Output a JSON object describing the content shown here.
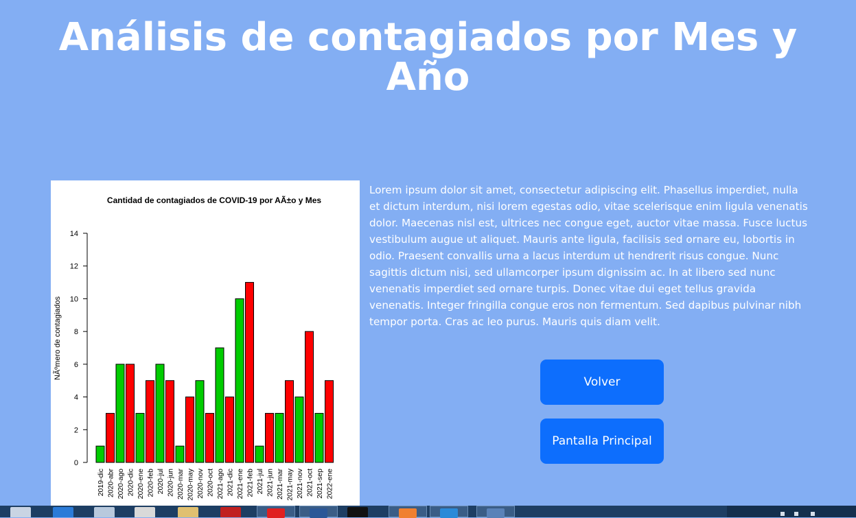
{
  "page": {
    "title": "Análisis de contagiados por Mes y Año",
    "description": "Lorem ipsum dolor sit amet, consectetur adipiscing elit. Phasellus imperdiet, nulla et dictum interdum, nisi lorem egestas odio, vitae scelerisque enim ligula venenatis dolor. Maecenas nisl est, ultrices nec congue eget, auctor vitae massa. Fusce luctus vestibulum augue ut aliquet. Mauris ante ligula, facilisis sed ornare eu, lobortis in odio. Praesent convallis urna a lacus interdum ut hendrerit risus congue. Nunc sagittis dictum nisi, sed ullamcorper ipsum dignissim ac. In at libero sed nunc venenatis imperdiet sed ornare turpis. Donec vitae dui eget tellus gravida venenatis. Integer fringilla congue eros non fermentum. Sed dapibus pulvinar nibh tempor porta. Cras ac leo purus. Mauris quis diam velit."
  },
  "buttons": {
    "back_label": "Volver",
    "home_label": "Pantalla Principal"
  },
  "colors": {
    "background": "#83aef3",
    "button": "#0d6efd",
    "bar_green": "#00cc00",
    "bar_red": "#ff0000"
  },
  "taskbar": {
    "icons": [
      "app-icon",
      "mail-icon",
      "computer-icon",
      "media-icon",
      "folder-icon",
      "opera-icon",
      "opera-icon",
      "word-icon",
      "terminal-icon",
      "xampp-icon",
      "vscode-icon",
      "r-icon"
    ]
  },
  "chart_data": {
    "type": "bar",
    "title": "Cantidad de contagiados de COVID-19 por AÃ±o y Mes",
    "xlabel": "",
    "ylabel": "NÃºmero de contagiados",
    "ylim": [
      0,
      14
    ],
    "yticks": [
      0,
      2,
      4,
      6,
      8,
      10,
      12,
      14
    ],
    "grid": false,
    "categories": [
      "2019-dic",
      "2020-abr",
      "2020-ago",
      "2020-dic",
      "2020-ene",
      "2020-feb",
      "2020-jul",
      "2020-jun",
      "2020-mar",
      "2020-may",
      "2020-nov",
      "2020-oct",
      "2021-ago",
      "2021-dic",
      "2021-ene",
      "2021-feb",
      "2021-jul",
      "2021-jun",
      "2021-mar",
      "2021-may",
      "2021-nov",
      "2021-oct",
      "2021-sep",
      "2022-ene"
    ],
    "values": [
      1,
      3,
      6,
      6,
      3,
      5,
      6,
      5,
      1,
      4,
      5,
      3,
      7,
      4,
      10,
      11,
      1,
      3,
      3,
      5,
      4,
      8,
      3,
      5
    ],
    "bar_colors": [
      "#00cc00",
      "#ff0000",
      "#00cc00",
      "#ff0000",
      "#00cc00",
      "#ff0000",
      "#00cc00",
      "#ff0000",
      "#00cc00",
      "#ff0000",
      "#00cc00",
      "#ff0000",
      "#00cc00",
      "#ff0000",
      "#00cc00",
      "#ff0000",
      "#00cc00",
      "#ff0000",
      "#00cc00",
      "#ff0000",
      "#00cc00",
      "#ff0000",
      "#00cc00",
      "#ff0000"
    ]
  }
}
